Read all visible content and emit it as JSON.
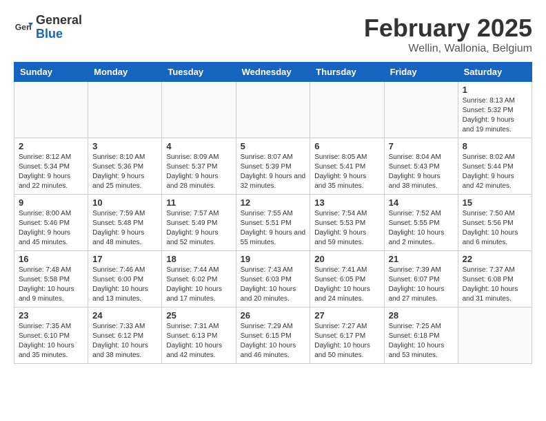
{
  "logo": {
    "general": "General",
    "blue": "Blue"
  },
  "title": "February 2025",
  "subtitle": "Wellin, Wallonia, Belgium",
  "days": [
    "Sunday",
    "Monday",
    "Tuesday",
    "Wednesday",
    "Thursday",
    "Friday",
    "Saturday"
  ],
  "weeks": [
    [
      {
        "num": "",
        "info": ""
      },
      {
        "num": "",
        "info": ""
      },
      {
        "num": "",
        "info": ""
      },
      {
        "num": "",
        "info": ""
      },
      {
        "num": "",
        "info": ""
      },
      {
        "num": "",
        "info": ""
      },
      {
        "num": "1",
        "info": "Sunrise: 8:13 AM\nSunset: 5:32 PM\nDaylight: 9 hours and 19 minutes."
      }
    ],
    [
      {
        "num": "2",
        "info": "Sunrise: 8:12 AM\nSunset: 5:34 PM\nDaylight: 9 hours and 22 minutes."
      },
      {
        "num": "3",
        "info": "Sunrise: 8:10 AM\nSunset: 5:36 PM\nDaylight: 9 hours and 25 minutes."
      },
      {
        "num": "4",
        "info": "Sunrise: 8:09 AM\nSunset: 5:37 PM\nDaylight: 9 hours and 28 minutes."
      },
      {
        "num": "5",
        "info": "Sunrise: 8:07 AM\nSunset: 5:39 PM\nDaylight: 9 hours and 32 minutes."
      },
      {
        "num": "6",
        "info": "Sunrise: 8:05 AM\nSunset: 5:41 PM\nDaylight: 9 hours and 35 minutes."
      },
      {
        "num": "7",
        "info": "Sunrise: 8:04 AM\nSunset: 5:43 PM\nDaylight: 9 hours and 38 minutes."
      },
      {
        "num": "8",
        "info": "Sunrise: 8:02 AM\nSunset: 5:44 PM\nDaylight: 9 hours and 42 minutes."
      }
    ],
    [
      {
        "num": "9",
        "info": "Sunrise: 8:00 AM\nSunset: 5:46 PM\nDaylight: 9 hours and 45 minutes."
      },
      {
        "num": "10",
        "info": "Sunrise: 7:59 AM\nSunset: 5:48 PM\nDaylight: 9 hours and 48 minutes."
      },
      {
        "num": "11",
        "info": "Sunrise: 7:57 AM\nSunset: 5:49 PM\nDaylight: 9 hours and 52 minutes."
      },
      {
        "num": "12",
        "info": "Sunrise: 7:55 AM\nSunset: 5:51 PM\nDaylight: 9 hours and 55 minutes."
      },
      {
        "num": "13",
        "info": "Sunrise: 7:54 AM\nSunset: 5:53 PM\nDaylight: 9 hours and 59 minutes."
      },
      {
        "num": "14",
        "info": "Sunrise: 7:52 AM\nSunset: 5:55 PM\nDaylight: 10 hours and 2 minutes."
      },
      {
        "num": "15",
        "info": "Sunrise: 7:50 AM\nSunset: 5:56 PM\nDaylight: 10 hours and 6 minutes."
      }
    ],
    [
      {
        "num": "16",
        "info": "Sunrise: 7:48 AM\nSunset: 5:58 PM\nDaylight: 10 hours and 9 minutes."
      },
      {
        "num": "17",
        "info": "Sunrise: 7:46 AM\nSunset: 6:00 PM\nDaylight: 10 hours and 13 minutes."
      },
      {
        "num": "18",
        "info": "Sunrise: 7:44 AM\nSunset: 6:02 PM\nDaylight: 10 hours and 17 minutes."
      },
      {
        "num": "19",
        "info": "Sunrise: 7:43 AM\nSunset: 6:03 PM\nDaylight: 10 hours and 20 minutes."
      },
      {
        "num": "20",
        "info": "Sunrise: 7:41 AM\nSunset: 6:05 PM\nDaylight: 10 hours and 24 minutes."
      },
      {
        "num": "21",
        "info": "Sunrise: 7:39 AM\nSunset: 6:07 PM\nDaylight: 10 hours and 27 minutes."
      },
      {
        "num": "22",
        "info": "Sunrise: 7:37 AM\nSunset: 6:08 PM\nDaylight: 10 hours and 31 minutes."
      }
    ],
    [
      {
        "num": "23",
        "info": "Sunrise: 7:35 AM\nSunset: 6:10 PM\nDaylight: 10 hours and 35 minutes."
      },
      {
        "num": "24",
        "info": "Sunrise: 7:33 AM\nSunset: 6:12 PM\nDaylight: 10 hours and 38 minutes."
      },
      {
        "num": "25",
        "info": "Sunrise: 7:31 AM\nSunset: 6:13 PM\nDaylight: 10 hours and 42 minutes."
      },
      {
        "num": "26",
        "info": "Sunrise: 7:29 AM\nSunset: 6:15 PM\nDaylight: 10 hours and 46 minutes."
      },
      {
        "num": "27",
        "info": "Sunrise: 7:27 AM\nSunset: 6:17 PM\nDaylight: 10 hours and 50 minutes."
      },
      {
        "num": "28",
        "info": "Sunrise: 7:25 AM\nSunset: 6:18 PM\nDaylight: 10 hours and 53 minutes."
      },
      {
        "num": "",
        "info": ""
      }
    ]
  ]
}
